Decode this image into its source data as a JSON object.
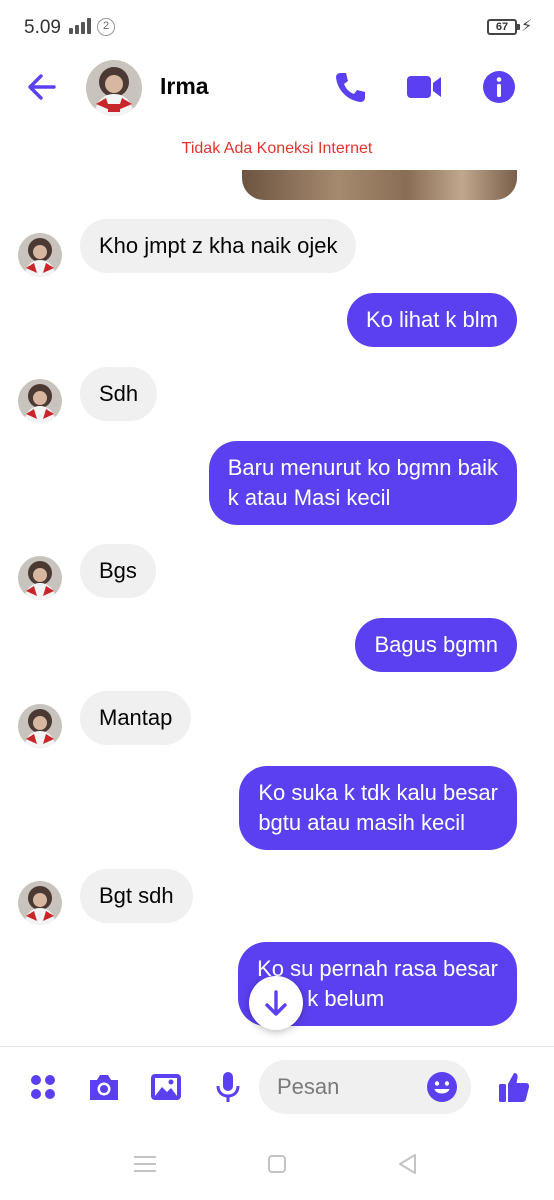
{
  "status_bar": {
    "time": "5.09",
    "sim_number": "2",
    "battery": "67"
  },
  "header": {
    "contact_name": "Irma",
    "icons": [
      "back-arrow-icon",
      "phone-icon",
      "video-camera-icon",
      "info-icon"
    ]
  },
  "banner": {
    "text": "Tidak Ada Koneksi Internet"
  },
  "messages": [
    {
      "from": "contact",
      "text": "Kho jmpt z kha naik ojek"
    },
    {
      "from": "me",
      "text": "Ko lihat k blm"
    },
    {
      "from": "contact",
      "text": "Sdh"
    },
    {
      "from": "me",
      "text": "Baru menurut ko bgmn baik\nk atau Masi kecil"
    },
    {
      "from": "contact",
      "text": "Bgs"
    },
    {
      "from": "me",
      "text": "Bagus bgmn"
    },
    {
      "from": "contact",
      "text": "Mantap"
    },
    {
      "from": "me",
      "text": "Ko suka k tdk kalu besar\nbgtu atau masih kecil"
    },
    {
      "from": "contact",
      "text": "Bgt sdh"
    },
    {
      "from": "me",
      "text": "Ko su pernah rasa besar\nbaru k belum"
    }
  ],
  "composer": {
    "placeholder": "Pesan",
    "icons": [
      "menu-dots-icon",
      "camera-icon",
      "gallery-icon",
      "microphone-icon",
      "emoji-icon",
      "thumbs-up-icon"
    ]
  },
  "colors": {
    "accent": "#5a40f0",
    "incoming_bubble": "#f0f0f0",
    "offline_text": "#e5332f"
  }
}
